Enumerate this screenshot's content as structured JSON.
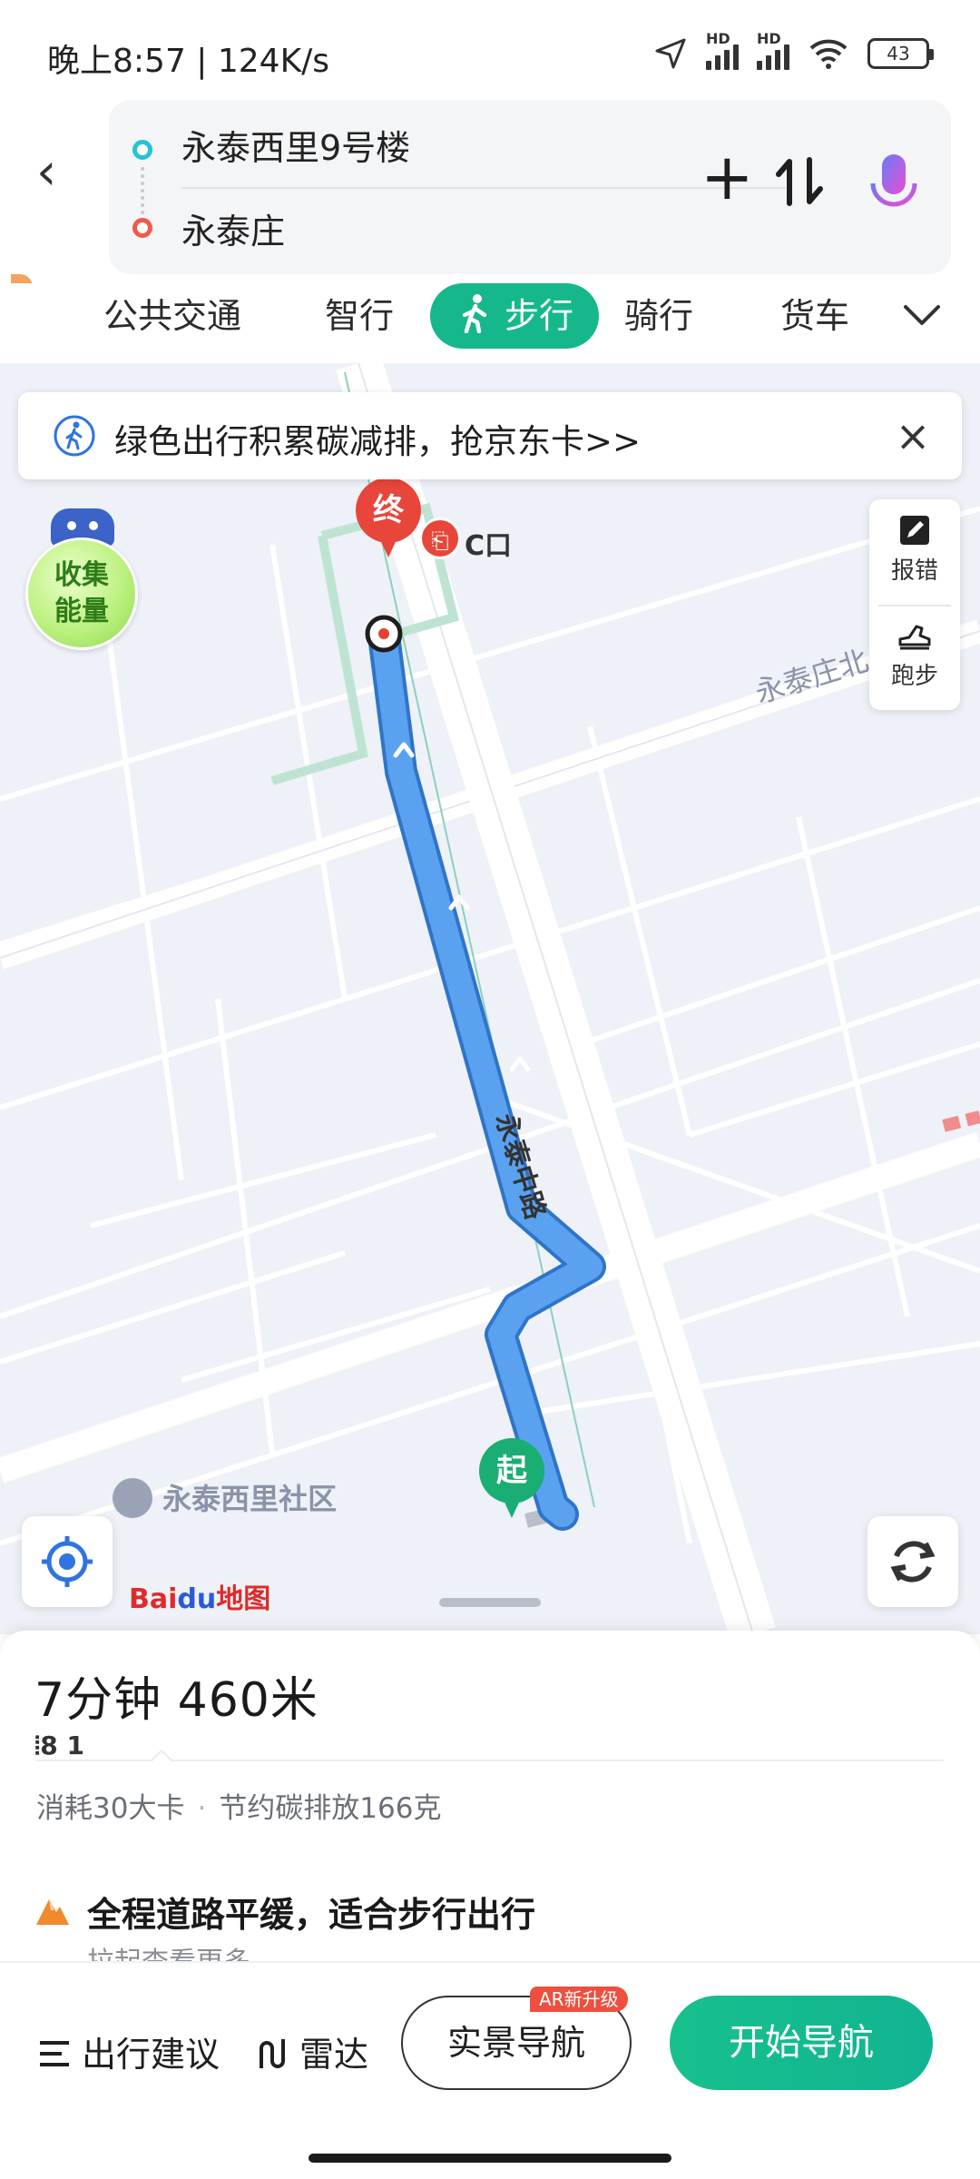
{
  "status": {
    "time": "晚上8:57 | 124K/s",
    "network": "HD",
    "battery": "43"
  },
  "route": {
    "from": "永泰西里9号楼",
    "to": "永泰庄"
  },
  "tabs": [
    "公共交通",
    "智行",
    "步行",
    "骑行",
    "货车"
  ],
  "active_tab": "步行",
  "banner": {
    "text": "绿色出行积累碳减排，抢京东卡>>"
  },
  "energy": {
    "label_line1": "收集",
    "label_line2": "能量"
  },
  "tools": {
    "report": "报错",
    "run": "跑步"
  },
  "map": {
    "end_marker": "终",
    "start_marker": "起",
    "exit_label": "C口",
    "road_main": "永泰中路",
    "road_ne": "永泰庄北",
    "community": "永泰西里社区",
    "logo_part1": "Bai",
    "logo_part2": "du",
    "logo_part3": "地图"
  },
  "summary": {
    "eta": "7分钟  460米",
    "lights": "8 1",
    "calories": "消耗30大卡",
    "separator": "·",
    "carbon": "节约碳排放166克",
    "tip": "全程道路平缓，适合步行出行",
    "sub": "拉起查看更多"
  },
  "bottom_bar": {
    "advice": "出行建议",
    "radar": "雷达",
    "ar_nav": "实景导航",
    "ar_badge": "AR新升级",
    "start_nav": "开始导航"
  },
  "colors": {
    "accent": "#16b88b",
    "route": "#4a90e8",
    "start_pin": "#1aae74",
    "end_pin": "#e8463a"
  }
}
